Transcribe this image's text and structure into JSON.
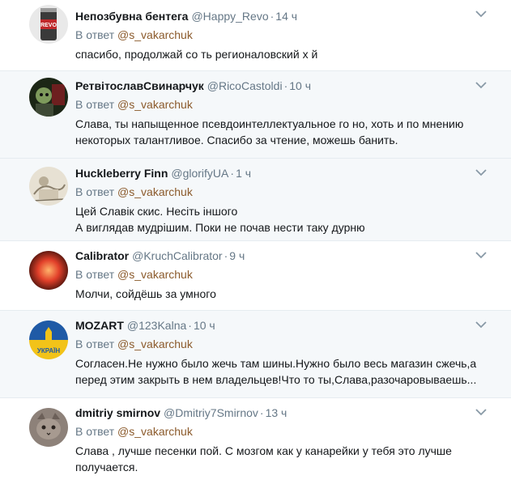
{
  "reply_prefix": "В ответ",
  "tweets": [
    {
      "name": "Непозбувна бентега",
      "handle": "@Happy_Revo",
      "time": "14 ч",
      "mention": "@s_vakarchuk",
      "lines": [
        "спасибо, продолжай со    ть регионаловский х  й"
      ],
      "avatar_text": "REVO"
    },
    {
      "name": "РетвітославСвинарчук",
      "handle": "@RicoCastoldi",
      "time": "10 ч",
      "mention": "@s_vakarchuk",
      "lines": [
        "Слава, ты напыщенное псевдоинтеллектуальное го  но, хоть и по мнению",
        "некоторых талантливое. Спасибо за чтение, можешь банить."
      ]
    },
    {
      "name": "Huckleberry Finn",
      "handle": "@glorifyUA",
      "time": "1 ч",
      "mention": "@s_vakarchuk",
      "lines": [
        "Цей Славік скис. Несіть іншого",
        "А виглядав мудрішим. Поки не почав нести таку дурню"
      ]
    },
    {
      "name": "Calibrator",
      "handle": "@KruchCalibrator",
      "time": "9 ч",
      "mention": "@s_vakarchuk",
      "lines": [
        "Молчи, сойдёшь за умного"
      ]
    },
    {
      "name": "MOZART",
      "handle": "@123Kalna",
      "time": "10 ч",
      "mention": "@s_vakarchuk",
      "lines": [
        "Согласен.Не нужно было жечь там шины.Нужно было весь магазин сжечь,а",
        "перед этим закрыть в нем владельцев!Что то ты,Слава,разочаровываешь..."
      ],
      "avatar_text": "УКРАЇН"
    },
    {
      "name": "dmitriy smirnov",
      "handle": "@Dmitriy7Smirnov",
      "time": "13 ч",
      "mention": "@s_vakarchuk",
      "lines": [
        "Слава , лучше песенки пой.  С мозгом как у канарейки у тебя это лучше",
        "получается."
      ]
    }
  ],
  "colors": {
    "name": "#14171a",
    "meta": "#657786",
    "mention": "#8b5a2b",
    "divider": "#e6ecf0",
    "alt_bg": "#f5f8fa"
  }
}
